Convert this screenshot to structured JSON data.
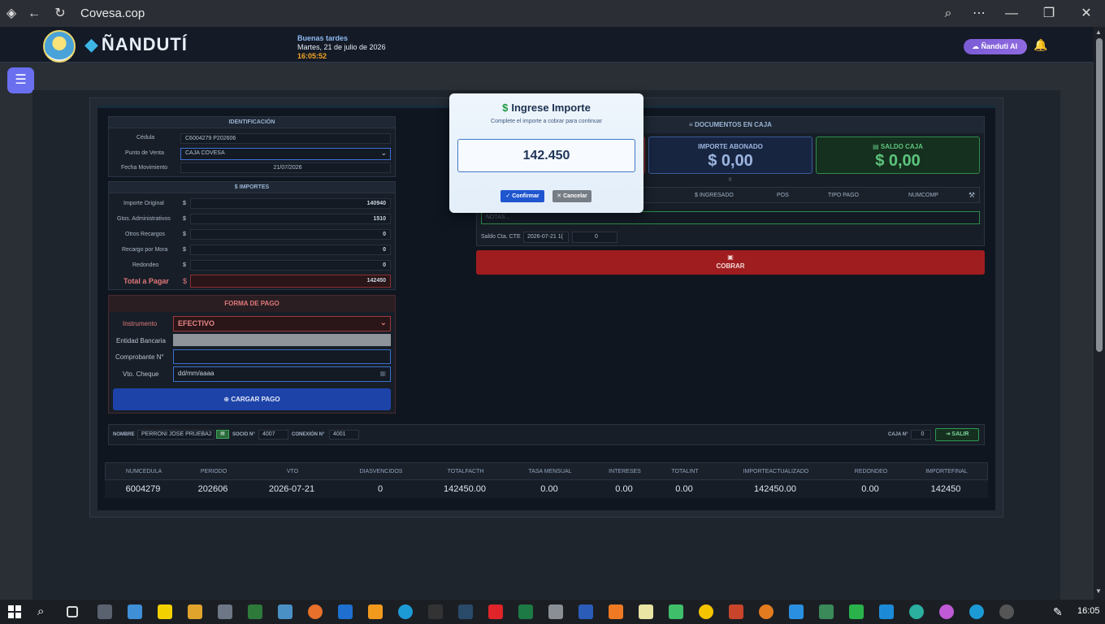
{
  "browser": {
    "title": "Covesa.cop"
  },
  "header": {
    "brand": "ÑANDUTÍ",
    "greeting": "Buenas tardes",
    "date": "Martes, 21 de julio de 2026",
    "time": "16:05:52",
    "ai_label": "Ñanduti AI"
  },
  "identificacion": {
    "title": "IDENTIFICACIÓN",
    "cedula_label": "Cédula",
    "cedula_value": "C6004279 P202606",
    "punto_label": "Punto de Venta",
    "punto_value": "CAJA COVESA",
    "fecha_label": "Fecha Movimiento",
    "fecha_value": "21/07/2026"
  },
  "importes": {
    "title": "$ IMPORTES",
    "rows": [
      {
        "label": "Importe Original",
        "value": "140940"
      },
      {
        "label": "Gtos. Administrativos",
        "value": "1510"
      },
      {
        "label": "Otros Recargos",
        "value": "0"
      },
      {
        "label": "Recargo por Mora",
        "value": "0"
      },
      {
        "label": "Redondeo",
        "value": "0"
      }
    ],
    "total_label": "Total a Pagar",
    "total_value": "142450",
    "currency": "$"
  },
  "forma_pago": {
    "title": "FORMA DE PAGO",
    "instrumento_label": "Instrumento",
    "instrumento_value": "EFECTIVO",
    "entidad_label": "Entidad Bancaria",
    "comprobante_label": "Comprobante N°",
    "vto_label": "Vto. Cheque",
    "vto_placeholder": "dd/mm/aaaa",
    "cargar_label": "CARGAR PAGO"
  },
  "documentos": {
    "title": "DOCUMENTOS EN CAJA",
    "abonado_title": "IMPORTE ABONADO",
    "abonado_value": "$ 0,00",
    "saldo_title": "SALDO CAJA",
    "saldo_value": "$ 0,00",
    "count": "0",
    "columns": [
      "$ INGRESADO",
      "POS",
      "TIPO PAGO",
      "NUMCOMP"
    ],
    "notas_placeholder": "NOTAS...",
    "saldo_cte_label": "Saldo Cta. CTE",
    "saldo_cte_date": "2026-07-21 1(",
    "saldo_cte_value": "0",
    "cobrar_label": "COBRAR"
  },
  "bottom": {
    "nombre_label": "NOMBRE",
    "nombre_value": "PERRONI JOSE PRUEBA2",
    "socio_label": "SOCIO N°",
    "socio_value": "4007",
    "conexion_label": "CONEXIÓN N°",
    "conexion_value": "4001",
    "caja_label": "CAJA N°",
    "caja_value": "0",
    "salir_label": "SALIR"
  },
  "table": {
    "headers": [
      "NUMCEDULA",
      "PERIODO",
      "VTO",
      "DIASVENCIDOS",
      "TOTALFACTH",
      "TASA MENSUAL",
      "INTERESES",
      "TOTALINT",
      "IMPORTEACTUALIZADO",
      "REDONDEO",
      "IMPORTEFINAL"
    ],
    "row": [
      "6004279",
      "202606",
      "2026-07-21",
      "0",
      "142450.00",
      "0.00",
      "0.00",
      "0.00",
      "142450.00",
      "0.00",
      "142450"
    ]
  },
  "modal": {
    "title": "Ingrese Importe",
    "subtitle": "Complete el importe a cobrar para continuar",
    "amount": "142.450",
    "confirm_label": "Confirmar",
    "cancel_label": "Cancelar"
  },
  "taskbar": {
    "time": "16:05"
  },
  "colors": {
    "accent": "#1f56cf",
    "danger": "#a01d1f",
    "success": "#2e9a52",
    "brand_purple": "#7b5cd6"
  }
}
